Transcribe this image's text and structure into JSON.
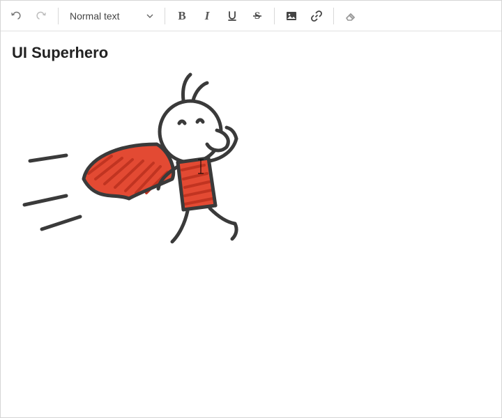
{
  "toolbar": {
    "style_select": "Normal text",
    "undo": "undo",
    "redo": "redo",
    "bold": "B",
    "italic": "I",
    "underline": "U",
    "strike": "S",
    "image": "image",
    "link": "link",
    "clear": "clear-format"
  },
  "content": {
    "heading": "UI Superhero",
    "image_alt": "Hand-drawn stick figure superhero with red cape running"
  }
}
